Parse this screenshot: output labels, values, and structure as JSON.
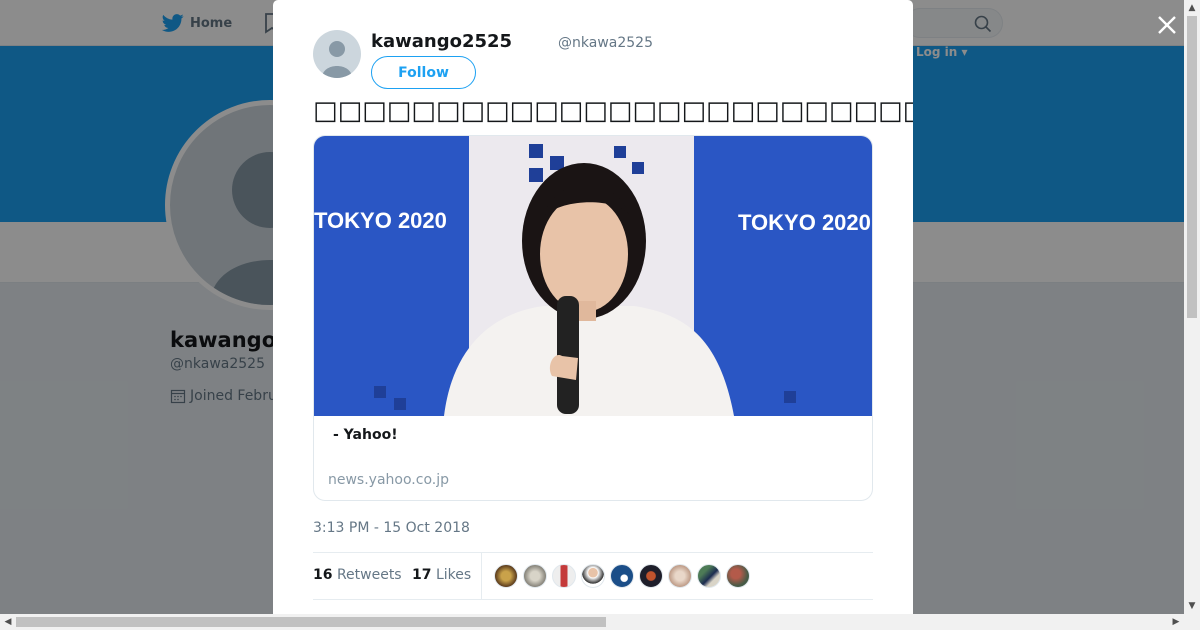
{
  "background": {
    "nav_home_label": "Home",
    "login_label": "Log in ▾",
    "profile_name": "kawango",
    "profile_handle": "@nkawa2525",
    "joined_label": "Joined Febru"
  },
  "tweet": {
    "author_name": "kawango2525",
    "author_handle": "@nkawa2525",
    "follow_label": "Follow",
    "text": "□□□□□□□□□□□□□□□□□□□□□□□□□□□□□□□□□□□□□□□□□□□□",
    "card_title": " - Yahoo!",
    "card_domain": "news.yahoo.co.jp",
    "card_image_banner_text": "TOKYO 2020",
    "timestamp": "3:13 PM - 15 Oct 2018",
    "retweets_count": "16",
    "retweets_label": "Retweets",
    "likes_count": "17",
    "likes_label": "Likes"
  },
  "likers": [
    "liker-avatar",
    "liker-avatar",
    "liker-avatar",
    "liker-avatar",
    "liker-avatar",
    "liker-avatar",
    "liker-avatar",
    "liker-avatar",
    "liker-avatar"
  ],
  "icons": {
    "twitter_bird": "twitter-bird-icon",
    "search": "search-icon",
    "close": "close-icon",
    "calendar": "calendar-icon"
  },
  "colors": {
    "accent": "#1da1f2",
    "text": "#14171a",
    "muted": "#657786"
  }
}
